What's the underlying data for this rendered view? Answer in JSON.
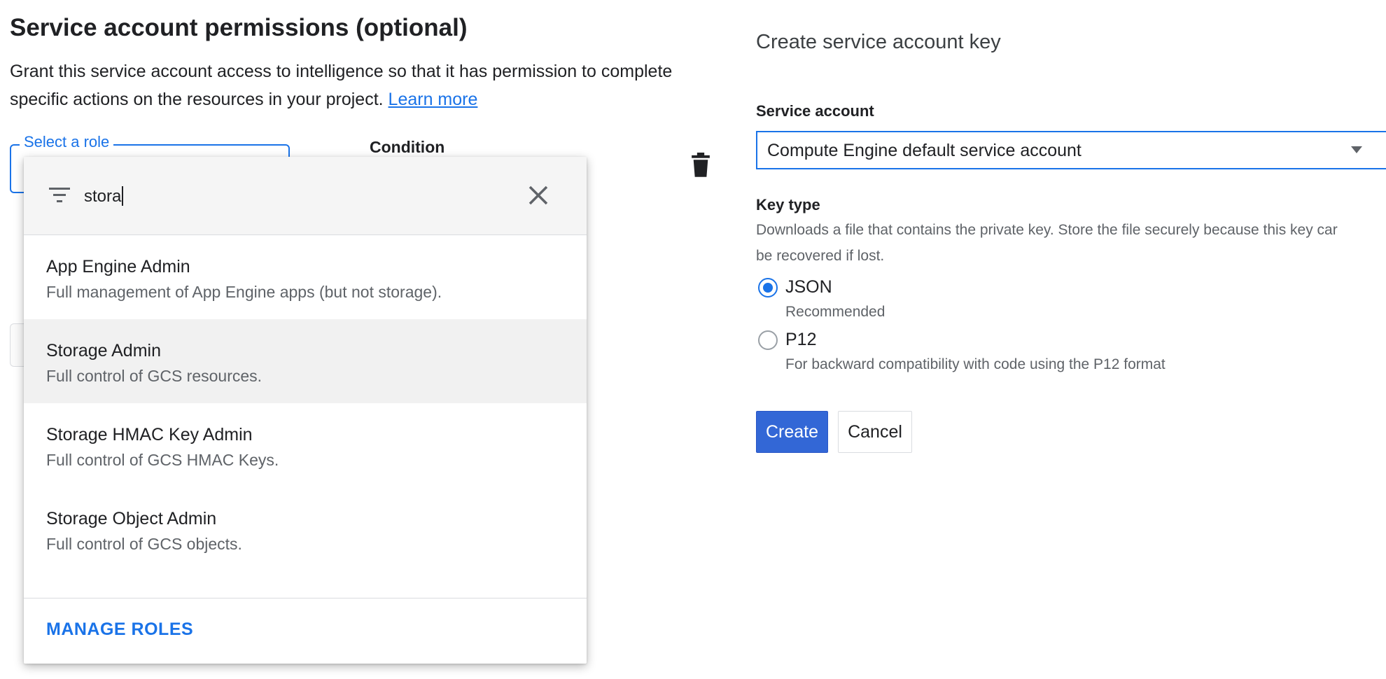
{
  "permissions": {
    "title": "Service account permissions (optional)",
    "description": "Grant this service account access to intelligence so that it has permission to complete specific actions on the resources in your project.",
    "learn_more": "Learn more",
    "role_label": "Select a role",
    "condition_label": "Condition"
  },
  "role_dropdown": {
    "search_value": "stora",
    "items": [
      {
        "title": "App Engine Admin",
        "subtitle": "Full management of App Engine apps (but not storage)."
      },
      {
        "title": "Storage Admin",
        "subtitle": "Full control of GCS resources.",
        "highlighted": true
      },
      {
        "title": "Storage HMAC Key Admin",
        "subtitle": "Full control of GCS HMAC Keys."
      },
      {
        "title": "Storage Object Admin",
        "subtitle": "Full control of GCS objects."
      }
    ],
    "manage_roles": "MANAGE ROLES"
  },
  "key_panel": {
    "title": "Create service account key",
    "service_account_label": "Service account",
    "service_account_value": "Compute Engine default service account",
    "key_type_label": "Key type",
    "key_type_description_line1": "Downloads a file that contains the private key. Store the file securely because this key car",
    "key_type_description_line2": "be recovered if lost.",
    "options": [
      {
        "label": "JSON",
        "sublabel": "Recommended",
        "selected": true
      },
      {
        "label": "P12",
        "sublabel": "For backward compatibility with code using the P12 format",
        "selected": false
      }
    ],
    "create_label": "Create",
    "cancel_label": "Cancel"
  },
  "colors": {
    "accent": "#1a73e8",
    "primary_button": "#3367d6",
    "highlight_row": "#f1f1f1"
  },
  "icons": [
    "filter-icon",
    "close-icon",
    "trash-icon",
    "dropdown-arrow-icon"
  ]
}
